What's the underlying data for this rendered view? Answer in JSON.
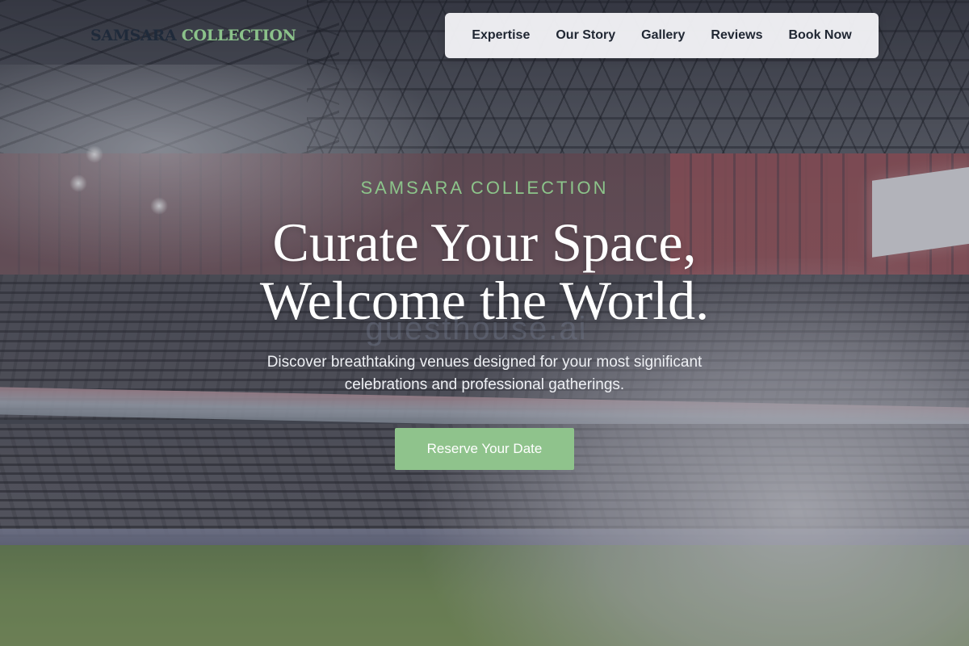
{
  "brand": {
    "logo_part1": "SAMSARA",
    "logo_part2": "COLLECTION"
  },
  "nav": {
    "items": [
      {
        "label": "Expertise"
      },
      {
        "label": "Our Story"
      },
      {
        "label": "Gallery"
      },
      {
        "label": "Reviews"
      },
      {
        "label": "Book Now"
      }
    ]
  },
  "hero": {
    "eyebrow": "SAMSARA COLLECTION",
    "headline_line1": "Curate Your Space,",
    "headline_line2": "Welcome the World.",
    "watermark": "guesthouse.ai",
    "subtitle_line1": "Discover breathtaking venues designed for your most significant",
    "subtitle_line2": "celebrations and professional gatherings.",
    "cta_label": "Reserve Your Date"
  },
  "colors": {
    "accent": "#8fc38c",
    "logo_dark": "#1f2a3a",
    "nav_bg": "#f2f3f6"
  }
}
